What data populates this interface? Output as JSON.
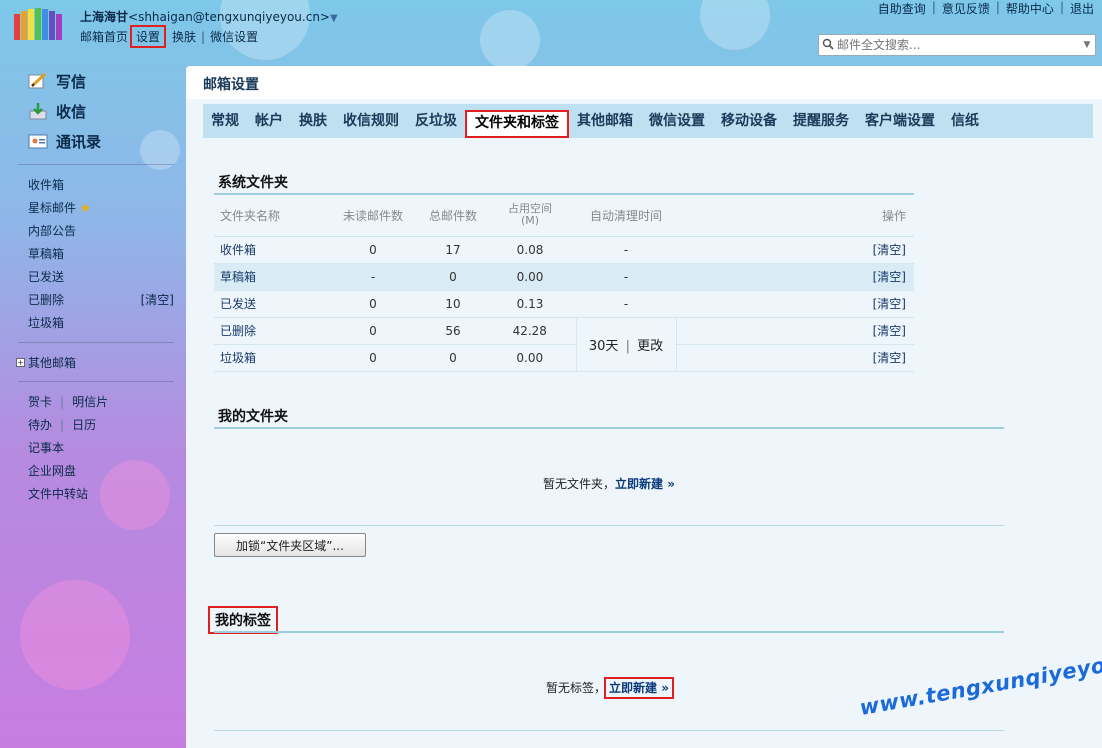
{
  "header": {
    "user_name": "上海海甘",
    "user_email": "<shhaigan@tengxunqiyeyou.cn>",
    "nav": [
      "邮箱首页",
      "设置",
      "换肤",
      "微信设置"
    ],
    "top_links": [
      "自助查询",
      "意见反馈",
      "帮助中心",
      "退出"
    ],
    "search_placeholder": "邮件全文搜索..."
  },
  "sidebar": {
    "main_buttons": [
      "写信",
      "收信",
      "通讯录"
    ],
    "folders": [
      {
        "label": "收件箱"
      },
      {
        "label": "星标邮件"
      },
      {
        "label": "内部公告"
      },
      {
        "label": "草稿箱"
      },
      {
        "label": "已发送"
      },
      {
        "label": "已删除",
        "action": "[清空]"
      },
      {
        "label": "垃圾箱"
      }
    ],
    "other_mail": "其他邮箱",
    "tools": {
      "card": "贺卡",
      "postcard": "明信片",
      "todo": "待办",
      "calendar": "日历",
      "notes": "记事本",
      "disk": "企业网盘",
      "transfer": "文件中转站"
    }
  },
  "panel": {
    "title": "邮箱设置",
    "tabs": [
      "常规",
      "帐户",
      "换肤",
      "收信规则",
      "反垃圾",
      "文件夹和标签",
      "其他邮箱",
      "微信设置",
      "移动设备",
      "提醒服务",
      "客户端设置",
      "信纸"
    ],
    "active_tab": "文件夹和标签",
    "system_folders": {
      "title": "系统文件夹",
      "headers": {
        "name": "文件夹名称",
        "unread": "未读邮件数",
        "total": "总邮件数",
        "space": "占用空间",
        "space_unit": "(M)",
        "auto_clean": "自动清理时间",
        "action": "操作"
      },
      "rows": [
        {
          "name": "收件箱",
          "unread": "0",
          "total": "17",
          "space": "0.08",
          "clean": "-",
          "action": "[清空]"
        },
        {
          "name": "草稿箱",
          "unread": "-",
          "total": "0",
          "space": "0.00",
          "clean": "-",
          "action": "[清空]"
        },
        {
          "name": "已发送",
          "unread": "0",
          "total": "10",
          "space": "0.13",
          "clean": "-",
          "action": "[清空]"
        },
        {
          "name": "已删除",
          "unread": "0",
          "total": "56",
          "space": "42.28",
          "action": "[清空]"
        },
        {
          "name": "垃圾箱",
          "unread": "0",
          "total": "0",
          "space": "0.00",
          "action": "[清空]"
        }
      ],
      "clean_days": "30天",
      "clean_change": "更改"
    },
    "my_folders": {
      "title": "我的文件夹",
      "empty_text": "暂无文件夹，",
      "create_link": "立即新建 »",
      "lock_button": "加锁“文件夹区域”..."
    },
    "my_labels": {
      "title": "我的标签",
      "empty_text": "暂无标签，",
      "create_link": "立即新建 »"
    }
  },
  "watermark": "www.tengxunqiyeyou.com",
  "colors": {
    "highlight_box": "#e02020",
    "tab_bar": "#bfe0f0",
    "panel_bg": "#eef5fb",
    "link": "#0a3a7a"
  }
}
